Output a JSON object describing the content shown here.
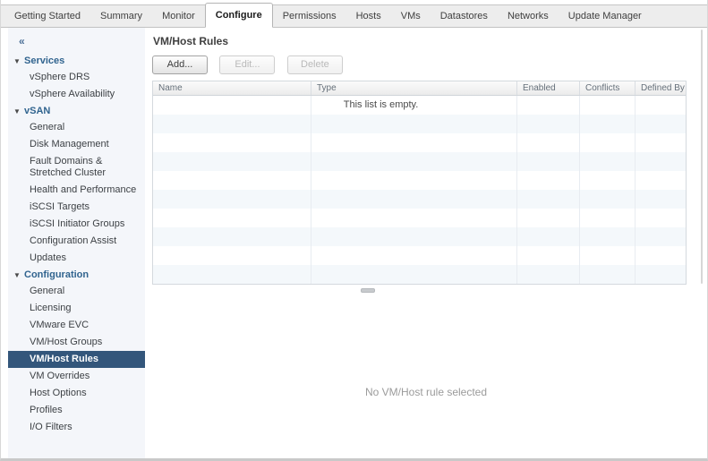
{
  "icons": {
    "collapse": "«",
    "section_arrow": "▼"
  },
  "tabs": {
    "items": [
      {
        "label": "Getting Started",
        "active": false
      },
      {
        "label": "Summary",
        "active": false
      },
      {
        "label": "Monitor",
        "active": false
      },
      {
        "label": "Configure",
        "active": true
      },
      {
        "label": "Permissions",
        "active": false
      },
      {
        "label": "Hosts",
        "active": false
      },
      {
        "label": "VMs",
        "active": false
      },
      {
        "label": "Datastores",
        "active": false
      },
      {
        "label": "Networks",
        "active": false
      },
      {
        "label": "Update Manager",
        "active": false
      }
    ]
  },
  "sidebar": {
    "sections": [
      {
        "label": "Services",
        "items": [
          "vSphere DRS",
          "vSphere Availability"
        ]
      },
      {
        "label": "vSAN",
        "items": [
          "General",
          "Disk Management",
          "Fault Domains & Stretched Cluster",
          "Health and Performance",
          "iSCSI Targets",
          "iSCSI Initiator Groups",
          "Configuration Assist",
          "Updates"
        ]
      },
      {
        "label": "Configuration",
        "items": [
          "General",
          "Licensing",
          "VMware EVC",
          "VM/Host Groups",
          "VM/Host Rules",
          "VM Overrides",
          "Host Options",
          "Profiles",
          "I/O Filters"
        ],
        "selected_item": "VM/Host Rules"
      }
    ]
  },
  "main": {
    "title": "VM/Host Rules",
    "toolbar": {
      "add_label": "Add...",
      "edit_label": "Edit...",
      "delete_label": "Delete"
    },
    "table": {
      "columns": [
        "Name",
        "Type",
        "Enabled",
        "Conflicts",
        "Defined By"
      ],
      "rows": [],
      "empty_message": "This list is empty."
    },
    "detail_placeholder": "No VM/Host rule selected"
  },
  "colors": {
    "selected_item_bg": "#33567B",
    "section_header_text": "#31648F",
    "tabbar_bg": "#EDEDED",
    "row_stripe": "#F4F8FB",
    "sidebar_bg": "#F4F6FA"
  }
}
